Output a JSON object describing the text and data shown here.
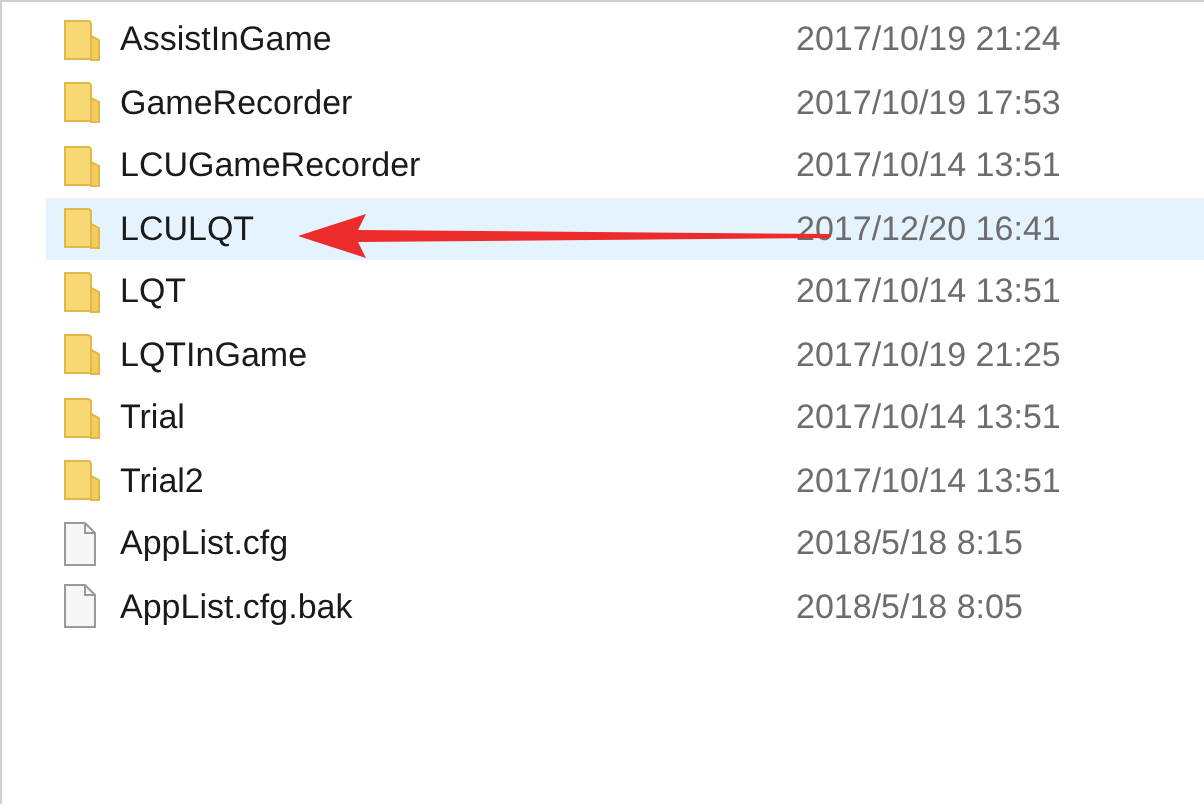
{
  "files": [
    {
      "kind": "folder",
      "name": "AssistInGame",
      "modified": "2017/10/19 21:24",
      "selected": false
    },
    {
      "kind": "folder",
      "name": "GameRecorder",
      "modified": "2017/10/19 17:53",
      "selected": false
    },
    {
      "kind": "folder",
      "name": "LCUGameRecorder",
      "modified": "2017/10/14 13:51",
      "selected": false
    },
    {
      "kind": "folder",
      "name": "LCULQT",
      "modified": "2017/12/20 16:41",
      "selected": true
    },
    {
      "kind": "folder",
      "name": "LQT",
      "modified": "2017/10/14 13:51",
      "selected": false
    },
    {
      "kind": "folder",
      "name": "LQTInGame",
      "modified": "2017/10/19 21:25",
      "selected": false
    },
    {
      "kind": "folder",
      "name": "Trial",
      "modified": "2017/10/14 13:51",
      "selected": false
    },
    {
      "kind": "folder",
      "name": "Trial2",
      "modified": "2017/10/14 13:51",
      "selected": false
    },
    {
      "kind": "file",
      "name": "AppList.cfg",
      "modified": "2018/5/18 8:15",
      "selected": false
    },
    {
      "kind": "file",
      "name": "AppList.cfg.bak",
      "modified": "2018/5/18 8:05",
      "selected": false
    }
  ]
}
